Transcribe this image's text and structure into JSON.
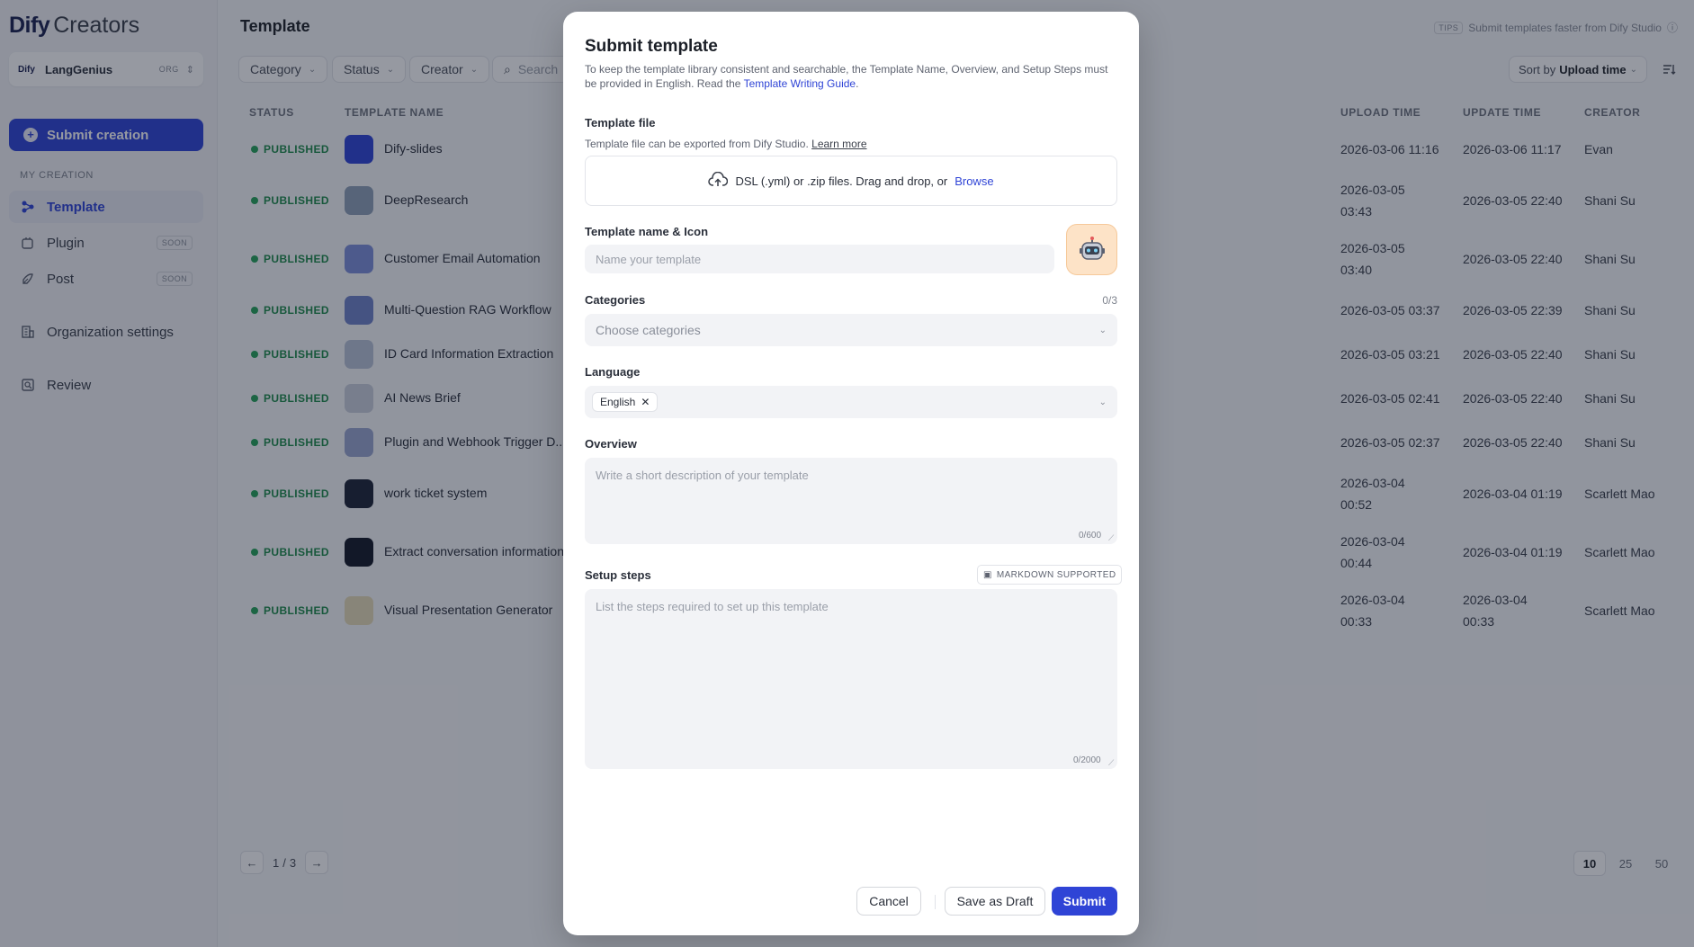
{
  "app": {
    "logo_brand": "Dify",
    "logo_suffix": "Creators"
  },
  "org": {
    "logo": "Dify",
    "name": "LangGenius",
    "tag": "ORG"
  },
  "sidebar": {
    "submit_label": "Submit creation",
    "section_label": "MY CREATION",
    "items": [
      {
        "label": "Template",
        "icon": "template-icon",
        "badge": ""
      },
      {
        "label": "Plugin",
        "icon": "plugin-icon",
        "badge": "SOON"
      },
      {
        "label": "Post",
        "icon": "post-icon",
        "badge": "SOON"
      },
      {
        "label": "Organization settings",
        "icon": "building-icon",
        "badge": ""
      },
      {
        "label": "Review",
        "icon": "review-icon",
        "badge": ""
      }
    ]
  },
  "header": {
    "title": "Template",
    "tips_tag": "TIPS",
    "tips_text": "Submit templates faster from Dify Studio"
  },
  "filters": {
    "category": "Category",
    "status": "Status",
    "creator": "Creator",
    "search_placeholder": "Search",
    "sort_prefix": "Sort by",
    "sort_value": "Upload time"
  },
  "table": {
    "columns": {
      "status": "STATUS",
      "name": "TEMPLATE NAME",
      "upload": "UPLOAD TIME",
      "update": "UPDATE TIME",
      "creator": "CREATOR"
    },
    "rows": [
      {
        "status": "PUBLISHED",
        "name": "Dify-slides",
        "upload1": "2026-03-06 11:16",
        "upload2": "",
        "update1": "2026-03-06 11:17",
        "update2": "",
        "creator": "Evan"
      },
      {
        "status": "PUBLISHED",
        "name": "DeepResearch",
        "upload1": "2026-03-05",
        "upload2": "03:43",
        "update1": "2026-03-05 22:40",
        "update2": "",
        "creator": "Shani Su"
      },
      {
        "status": "PUBLISHED",
        "name": "Customer Email Automation",
        "upload1": "2026-03-05",
        "upload2": "03:40",
        "update1": "2026-03-05 22:40",
        "update2": "",
        "creator": "Shani Su"
      },
      {
        "status": "PUBLISHED",
        "name": "Multi-Question RAG Workflow",
        "upload1": "2026-03-05 03:37",
        "upload2": "",
        "update1": "2026-03-05 22:39",
        "update2": "",
        "creator": "Shani Su"
      },
      {
        "status": "PUBLISHED",
        "name": "ID Card Information Extraction",
        "upload1": "2026-03-05 03:21",
        "upload2": "",
        "update1": "2026-03-05 22:40",
        "update2": "",
        "creator": "Shani Su"
      },
      {
        "status": "PUBLISHED",
        "name": "AI News Brief",
        "upload1": "2026-03-05 02:41",
        "upload2": "",
        "update1": "2026-03-05 22:40",
        "update2": "",
        "creator": "Shani Su"
      },
      {
        "status": "PUBLISHED",
        "name": "Plugin and Webhook Trigger D...",
        "upload1": "2026-03-05 02:37",
        "upload2": "",
        "update1": "2026-03-05 22:40",
        "update2": "",
        "creator": "Shani Su"
      },
      {
        "status": "PUBLISHED",
        "name": "work ticket system",
        "upload1": "2026-03-04",
        "upload2": "00:52",
        "update1": "2026-03-04 01:19",
        "update2": "",
        "creator": "Scarlett Mao"
      },
      {
        "status": "PUBLISHED",
        "name": "Extract conversation information",
        "upload1": "2026-03-04",
        "upload2": "00:44",
        "update1": "2026-03-04 01:19",
        "update2": "",
        "creator": "Scarlett Mao"
      },
      {
        "status": "PUBLISHED",
        "name": "Visual Presentation Generator",
        "upload1": "2026-03-04",
        "upload2": "00:33",
        "update1": "2026-03-04",
        "update2": "00:33",
        "creator": "Scarlett Mao"
      }
    ]
  },
  "pagination": {
    "page": "1",
    "separator": "/",
    "total": "3",
    "sizes": [
      "10",
      "25",
      "50"
    ]
  },
  "modal": {
    "title": "Submit template",
    "desc_main": "To keep the template library consistent and searchable, the Template Name, Overview, and Setup Steps must be provided in English. Read the ",
    "desc_link": "Template Writing Guide",
    "desc_end": ".",
    "file_label": "Template file",
    "file_sub": "Template file can be exported from Dify Studio.",
    "file_learn": "Learn more",
    "drop_text": "DSL (.yml) or .zip files. Drag and drop, or",
    "drop_browse": "Browse",
    "name_label": "Template name & Icon",
    "name_placeholder": "Name your template",
    "categories_label": "Categories",
    "categories_count": "0/3",
    "categories_placeholder": "Choose categories",
    "language_label": "Language",
    "language_value": "English",
    "overview_label": "Overview",
    "overview_placeholder": "Write a short description of your template",
    "overview_count": "0/600",
    "setup_label": "Setup steps",
    "markdown_badge": "MARKDOWN SUPPORTED",
    "setup_placeholder": "List the steps required to set up this template",
    "setup_count": "0/2000",
    "cancel": "Cancel",
    "draft": "Save as Draft",
    "submit": "Submit"
  },
  "colors": {
    "accent": "#2f44d6",
    "published": "#27a35a",
    "overlay": "rgba(16,22,40,0.44)"
  }
}
